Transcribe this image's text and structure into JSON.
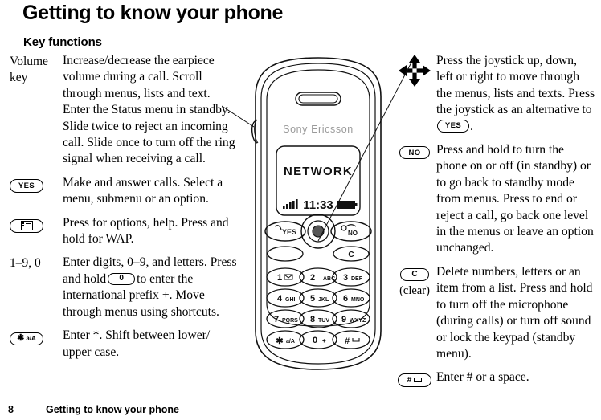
{
  "page": {
    "title": "Getting to know your phone",
    "section_heading": "Key functions"
  },
  "footer": {
    "page_number": "8",
    "title": "Getting to know your phone"
  },
  "left_column": [
    {
      "key_type": "text",
      "key_label": "Volume key",
      "description": "Increase/decrease the earpiece volume during a call. Scroll through menus, lists and text. Enter the Status menu in standby. Slide twice to reject an incoming call. Slide once to turn off the ring signal when receiving a call."
    },
    {
      "key_type": "oval",
      "key_label": "YES",
      "description": "Make and answer calls. Select a menu, submenu or an option."
    },
    {
      "key_type": "oval-icon",
      "key_label": "options-menu-icon",
      "description": "Press for options, help. Press and hold for WAP."
    },
    {
      "key_type": "text",
      "key_label": "1–9, 0",
      "description_part1": "Enter digits, 0–9, and letters. Press and hold",
      "inline_key": "0",
      "description_part2": "to enter the international prefix +. Move through menus using shortcuts."
    },
    {
      "key_type": "oval",
      "key_label": "✱ a/A",
      "description": "Enter *. Shift between lower/ upper case."
    }
  ],
  "right_column": [
    {
      "key_type": "joystick",
      "key_label": "joystick-arrows-icon",
      "description_part1": "Press the joystick up, down, left or right to move through the menus, lists and texts. Press the joystick as an alternative to",
      "inline_key": "YES",
      "description_part2": "."
    },
    {
      "key_type": "oval",
      "key_label": "NO",
      "description": "Press and hold to turn the phone on or off (in standby) or to go back to standby mode from menus. Press to end or reject a call, go back one level in the menus or leave an option unchanged."
    },
    {
      "key_type": "oval",
      "key_label": "C",
      "key_sublabel": "(clear)",
      "description": "Delete numbers, letters or an item from a list. Press and hold to turn off the microphone (during calls) or turn off sound or lock the keypad (standby menu)."
    },
    {
      "key_type": "oval-hash",
      "key_label": "#",
      "description": "Enter # or a space."
    }
  ],
  "phone": {
    "brand": "Sony Ericsson",
    "screen_text": "NETWORK",
    "clock": "11:33",
    "signal_icon": "signal-bars-icon",
    "battery_icon": "battery-icon",
    "keys": {
      "row1": [
        "YES",
        "joystick",
        "NO"
      ],
      "row2": [
        "options",
        "C"
      ],
      "keypad": [
        [
          "1",
          "2",
          "3"
        ],
        [
          "4",
          "5",
          "6"
        ],
        [
          "7",
          "8",
          "9"
        ],
        [
          "*",
          "0",
          "#"
        ]
      ],
      "key_letters": {
        "1": "",
        "2": "ABC",
        "3": "DEF",
        "4": "GHI",
        "5": "JKL",
        "6": "MNO",
        "7": "PQRS",
        "8": "TUV",
        "9": "WXYZ",
        "star": "a/A",
        "0": "+",
        "hash": ""
      }
    }
  },
  "colors": {
    "ink": "#000000",
    "paper": "#ffffff",
    "brand_gray": "#9a9a9a",
    "outline": "#1a1a1a"
  }
}
